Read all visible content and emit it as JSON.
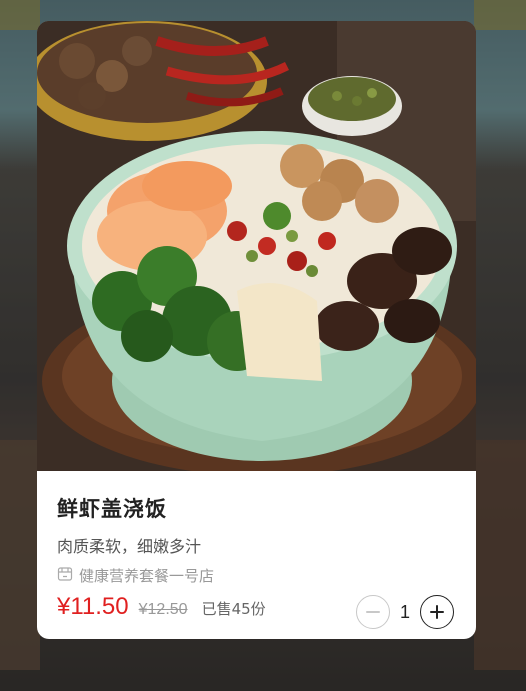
{
  "dish": {
    "name": "鲜虾盖浇饭",
    "description": "肉质柔软，细嫩多汁",
    "shop_name": "健康营养套餐一号店",
    "price": "¥11.50",
    "original_price": "¥12.50",
    "sold": "已售45份"
  },
  "cart": {
    "quantity": "1"
  },
  "icons": {
    "shop": "shop-icon",
    "decrease": "minus-circle-icon",
    "increase": "plus-circle-icon"
  },
  "colors": {
    "price": "#e02020",
    "card_background": "#ffffff",
    "overlay": "rgba(0,0,0,0.35)"
  }
}
